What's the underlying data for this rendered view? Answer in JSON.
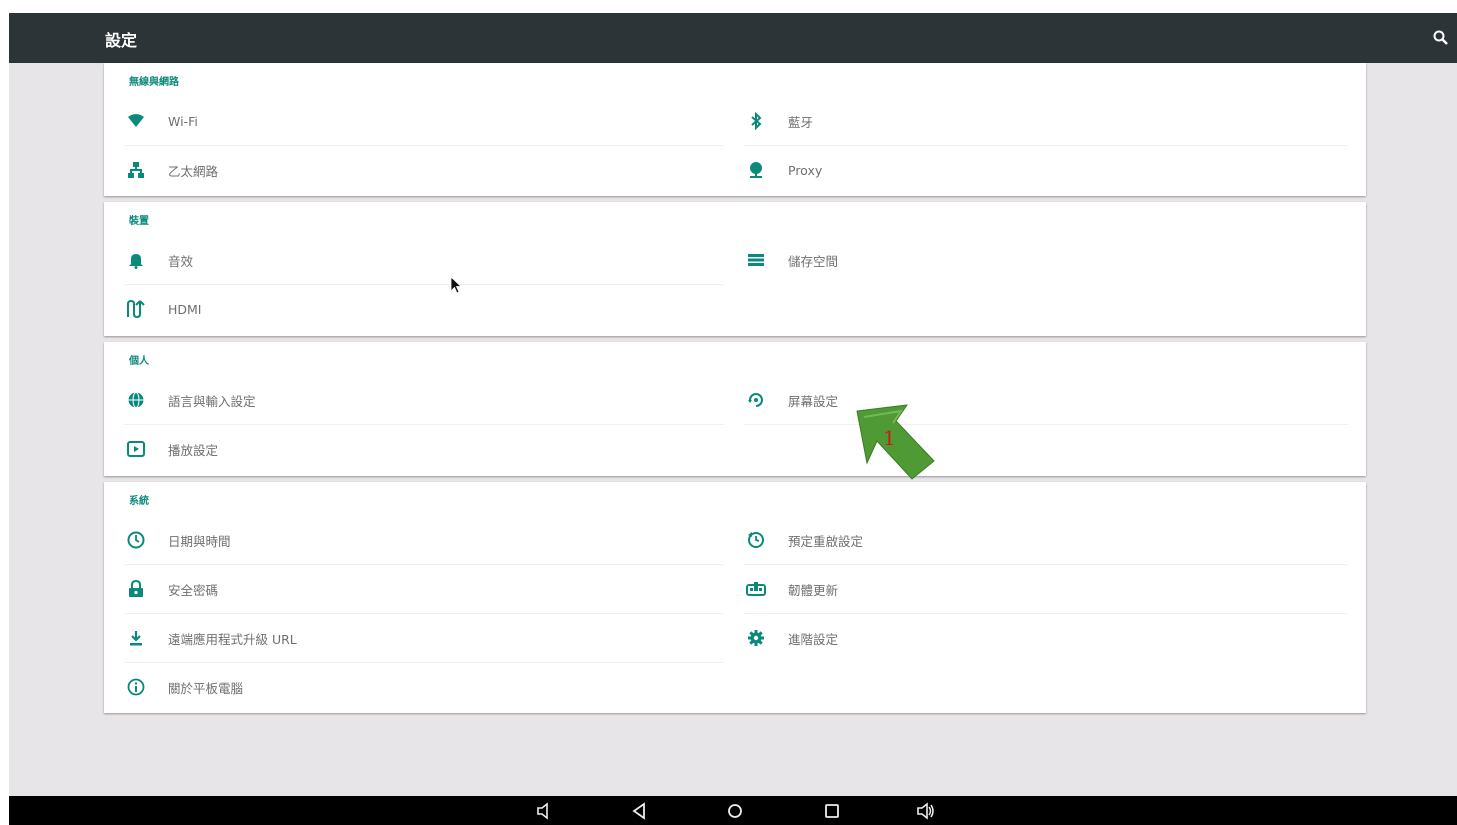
{
  "app_title": "設定",
  "accent": "#0b8a7c",
  "sections": [
    {
      "title": "無線與網路",
      "items": [
        {
          "label": "Wi-Fi",
          "icon": "wifi-icon"
        },
        {
          "label": "藍牙",
          "icon": "bluetooth-icon"
        },
        {
          "label": "乙太網路",
          "icon": "ethernet-icon"
        },
        {
          "label": "Proxy",
          "icon": "proxy-icon"
        }
      ]
    },
    {
      "title": "裝置",
      "items": [
        {
          "label": "音效",
          "icon": "bell-icon"
        },
        {
          "label": "儲存空間",
          "icon": "storage-icon"
        },
        {
          "label": "HDMI",
          "icon": "hdmi-icon"
        }
      ]
    },
    {
      "title": "個人",
      "items": [
        {
          "label": "語言與輸入設定",
          "icon": "globe-icon"
        },
        {
          "label": "屏幕設定",
          "icon": "screen-rotate-icon"
        },
        {
          "label": "播放設定",
          "icon": "play-icon"
        }
      ]
    },
    {
      "title": "系統",
      "items": [
        {
          "label": "日期與時間",
          "icon": "clock-icon"
        },
        {
          "label": "預定重啟設定",
          "icon": "schedule-icon"
        },
        {
          "label": "安全密碼",
          "icon": "lock-icon"
        },
        {
          "label": "韌體更新",
          "icon": "firmware-update-icon"
        },
        {
          "label": "遠端應用程式升級 URL",
          "icon": "download-icon"
        },
        {
          "label": "進階設定",
          "icon": "gear-icon"
        },
        {
          "label": "關於平板電腦",
          "icon": "info-icon"
        }
      ]
    }
  ],
  "annotation": {
    "number": "1",
    "color": "#4f9a35"
  },
  "navbar": [
    "volume-down-icon",
    "back-icon",
    "home-icon",
    "recents-icon",
    "volume-up-icon"
  ]
}
